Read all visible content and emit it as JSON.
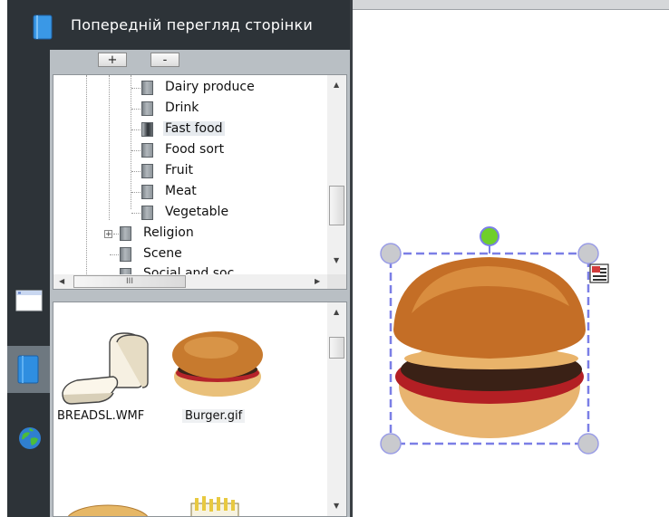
{
  "header": {
    "title": "Попередній перегляд сторінки"
  },
  "toolbar": {
    "plus_label": "+",
    "minus_label": "-"
  },
  "tree": {
    "items": [
      {
        "label": "Dairy produce",
        "selected": false
      },
      {
        "label": "Drink",
        "selected": false
      },
      {
        "label": "Fast food",
        "selected": true
      },
      {
        "label": "Food sort",
        "selected": false
      },
      {
        "label": "Fruit",
        "selected": false
      },
      {
        "label": "Meat",
        "selected": false
      },
      {
        "label": "Vegetable",
        "selected": false
      },
      {
        "label": "Religion",
        "selected": false
      },
      {
        "label": "Scene",
        "selected": false
      },
      {
        "label": "Social and soc...",
        "selected": false
      }
    ],
    "hscroll_label": "III"
  },
  "thumbnails": [
    {
      "name": "BREADSL.WMF",
      "icon": "bread-slice-icon"
    },
    {
      "name": "Burger.gif",
      "icon": "burger-icon"
    }
  ],
  "sidebar_tabs": [
    {
      "icon": "page-window-icon"
    },
    {
      "icon": "gallery-book-icon",
      "active": true
    },
    {
      "icon": "globe-icon"
    }
  ],
  "canvas": {
    "object": "burger-image",
    "selection_color": "#7b7fe6",
    "rotate_handle_color": "#6fcf2a"
  }
}
